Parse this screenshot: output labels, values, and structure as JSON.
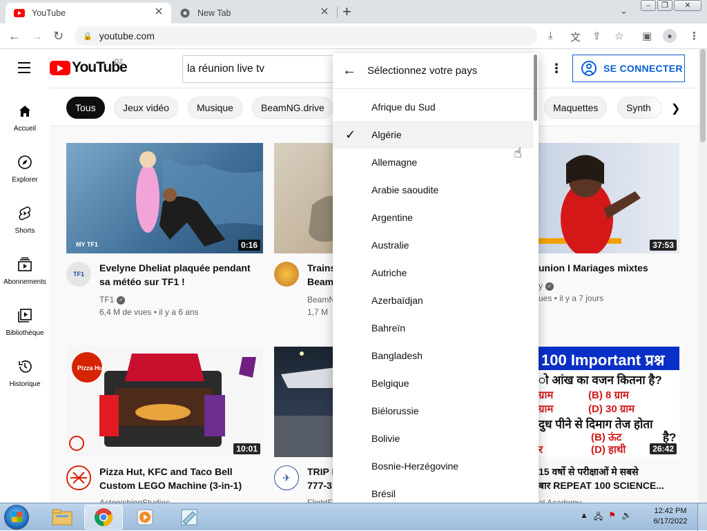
{
  "browser": {
    "tabs": [
      {
        "title": "YouTube",
        "active": true
      },
      {
        "title": "New Tab",
        "active": false
      }
    ],
    "url": "youtube.com"
  },
  "youtube": {
    "logo_text": "YouTube",
    "country_code": "DZ",
    "search_query": "la réunion live tv",
    "signin_label": "SE CONNECTER",
    "sidebar": [
      {
        "label": "Accueil",
        "icon": "home-icon"
      },
      {
        "label": "Explorer",
        "icon": "compass-icon"
      },
      {
        "label": "Shorts",
        "icon": "shorts-icon"
      },
      {
        "label": "Abonnements",
        "icon": "subscriptions-icon"
      },
      {
        "label": "Bibliothèque",
        "icon": "library-icon"
      },
      {
        "label": "Historique",
        "icon": "history-icon"
      }
    ],
    "chips": [
      "Tous",
      "Jeux vidéo",
      "Musique",
      "BeamNG.drive",
      "Maquettes",
      "Synth"
    ],
    "videos": [
      {
        "title_line1": "Evelyne Dheliat plaquée pendant",
        "title_line2": "sa météo sur TF1 !",
        "channel": "TF1",
        "meta": "6,4 M de vues • il y a 6 ans",
        "duration": "0:16",
        "avatar_text": "TF1"
      },
      {
        "title_line1": "Trains",
        "title_line2": "Beam",
        "channel": "BeamN",
        "meta": "1,7 M",
        "duration": ""
      },
      {
        "title_line1": "union I Mariages mixtes",
        "title_line2": "",
        "channel": "y",
        "meta": "ues • il y a 7 jours",
        "duration": "37:53"
      },
      {
        "title_line1": "Pizza Hut, KFC and Taco Bell",
        "title_line2": "Custom LEGO Machine (3-in-1)",
        "channel": "AstonishingStudios",
        "meta": "",
        "duration": "10:01"
      },
      {
        "title_line1": "TRIP I",
        "title_line2": "777-3",
        "channel": "FlightF",
        "meta": "",
        "duration": "",
        "avatar_text": "PEMOA"
      },
      {
        "title_line1": "15 वर्षो से परीक्षाओं मे सबसे",
        "title_line2": "बार REPEAT 100 SCIENCE...",
        "channel": "al Academy",
        "meta": "",
        "duration": "26:42",
        "thumb_lines": [
          "100 Important प्रश्न",
          "ो आंख का वजन कितना है?",
          "ग्राम",
          "(B) 8 ग्राम",
          "ग्राम",
          "(D) 30 ग्राम",
          "दुध पीने से दिमाग तेज होता",
          "(B) ऊंट",
          "है?",
          "र",
          "(D) हाथी"
        ]
      }
    ],
    "country_menu": {
      "title": "Sélectionnez votre pays",
      "selected": "Algérie",
      "countries": [
        "Afrique du Sud",
        "Algérie",
        "Allemagne",
        "Arabie saoudite",
        "Argentine",
        "Australie",
        "Autriche",
        "Azerbaïdjan",
        "Bahreïn",
        "Bangladesh",
        "Belgique",
        "Biélorussie",
        "Bolivie",
        "Bosnie-Herzégovine",
        "Brésil"
      ]
    }
  },
  "taskbar": {
    "time": "12:42 PM",
    "date": "6/17/2022"
  },
  "colors": {
    "brand_red": "#ff0000",
    "link_blue": "#065fd4"
  }
}
